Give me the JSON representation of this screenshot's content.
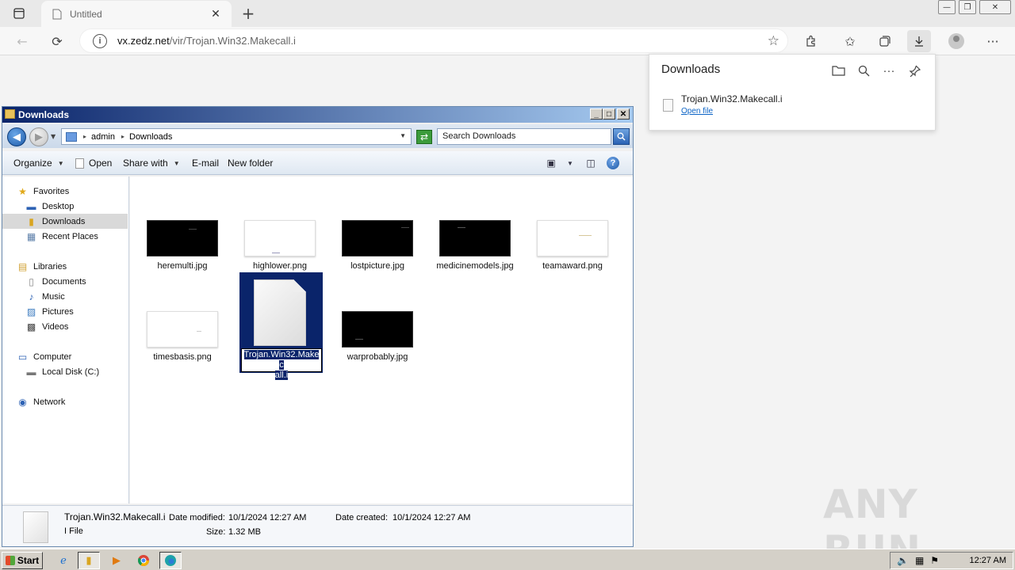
{
  "browser": {
    "tab_title": "Untitled",
    "url_host": "vx.zedz.net",
    "url_path": "/vir/Trojan.Win32.Makecall.i"
  },
  "downloads_flyout": {
    "title": "Downloads",
    "file_name": "Trojan.Win32.Makecall.i",
    "open_label": "Open file"
  },
  "explorer": {
    "title": "Downloads",
    "breadcrumb": [
      "admin",
      "Downloads"
    ],
    "search_placeholder": "Search Downloads",
    "commands": {
      "organize": "Organize",
      "open": "Open",
      "share_with": "Share with",
      "email": "E-mail",
      "new_folder": "New folder"
    },
    "nav": {
      "favorites": "Favorites",
      "desktop": "Desktop",
      "downloads": "Downloads",
      "recent_places": "Recent Places",
      "libraries": "Libraries",
      "documents": "Documents",
      "music": "Music",
      "pictures": "Pictures",
      "videos": "Videos",
      "computer": "Computer",
      "local_disk": "Local Disk (C:)",
      "network": "Network"
    },
    "files": [
      {
        "name": "heremulti.jpg",
        "thumb": "dark"
      },
      {
        "name": "highlower.png",
        "thumb": "light"
      },
      {
        "name": "lostpicture.jpg",
        "thumb": "dark"
      },
      {
        "name": "medicinemodels.jpg",
        "thumb": "dark"
      },
      {
        "name": "teamaward.png",
        "thumb": "light"
      },
      {
        "name": "timesbasis.png",
        "thumb": "light"
      },
      {
        "name": "Trojan.Win32.Makecall.i",
        "thumb": "document"
      },
      {
        "name": "warprobably.jpg",
        "thumb": "dark"
      }
    ],
    "rename_text_a": "Trojan.Win32.Makec",
    "rename_text_b": "all.i",
    "details": {
      "name": "Trojan.Win32.Makecall.i",
      "type": "I File",
      "modified_label": "Date modified:",
      "modified_value": "10/1/2024 12:27 AM",
      "created_label": "Date created:",
      "created_value": "10/1/2024 12:27 AM",
      "size_label": "Size:",
      "size_value": "1.32 MB"
    }
  },
  "taskbar": {
    "start_label": "Start",
    "clock": "12:27 AM"
  },
  "watermark": "ANY RUN",
  "colors": {
    "selection": "#0a246a",
    "link": "#0b63c5",
    "title_gradient_start": "#0a246a"
  }
}
